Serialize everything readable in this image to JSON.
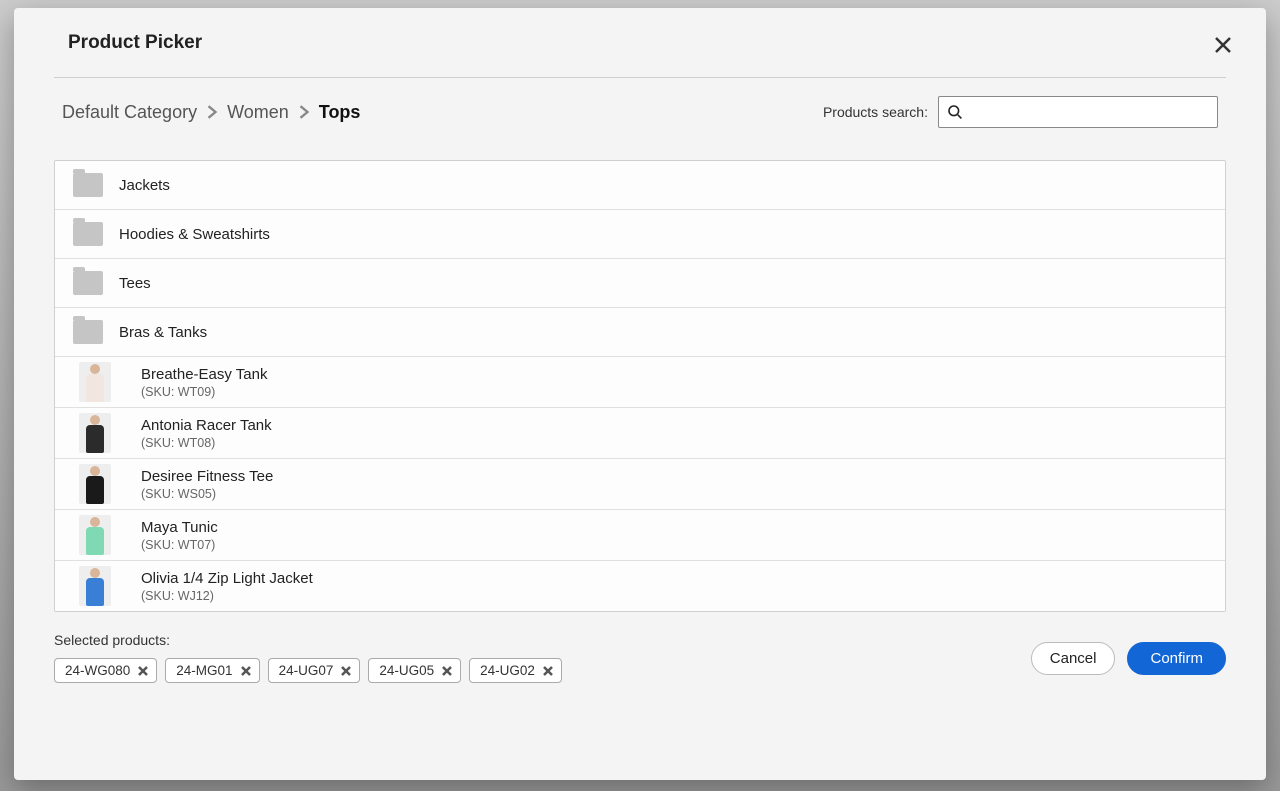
{
  "modal": {
    "title": "Product Picker"
  },
  "breadcrumbs": [
    {
      "label": "Default Category",
      "current": false
    },
    {
      "label": "Women",
      "current": false
    },
    {
      "label": "Tops",
      "current": true
    }
  ],
  "search": {
    "label": "Products search:",
    "value": ""
  },
  "categories": [
    {
      "label": "Jackets"
    },
    {
      "label": "Hoodies & Sweatshirts"
    },
    {
      "label": "Tees"
    },
    {
      "label": "Bras & Tanks"
    }
  ],
  "products": [
    {
      "name": "Breathe-Easy Tank",
      "sku": "(SKU: WT09)",
      "color": "#f2e6e0"
    },
    {
      "name": "Antonia Racer Tank",
      "sku": "(SKU: WT08)",
      "color": "#2b2b2b"
    },
    {
      "name": "Desiree Fitness Tee",
      "sku": "(SKU: WS05)",
      "color": "#1a1a1a"
    },
    {
      "name": "Maya Tunic",
      "sku": "(SKU: WT07)",
      "color": "#7fd9b3"
    },
    {
      "name": "Olivia 1/4 Zip Light Jacket",
      "sku": "(SKU: WJ12)",
      "color": "#3a7fd6"
    }
  ],
  "selected": {
    "label": "Selected products:",
    "items": [
      {
        "sku": "24-WG080"
      },
      {
        "sku": "24-MG01"
      },
      {
        "sku": "24-UG07"
      },
      {
        "sku": "24-UG05"
      },
      {
        "sku": "24-UG02"
      }
    ]
  },
  "actions": {
    "cancel": "Cancel",
    "confirm": "Confirm"
  }
}
